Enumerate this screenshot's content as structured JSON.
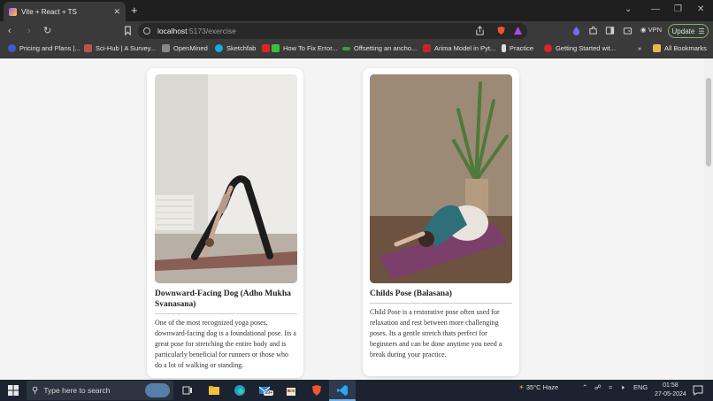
{
  "browser": {
    "tab_title": "Vite + React + TS",
    "new_tab": "+",
    "url_host": "localhost",
    "url_path": ":5173/exercise",
    "vpn_label": "VPN",
    "update_label": "Update",
    "window_controls": [
      "⌄",
      "—",
      "❐",
      "✕"
    ]
  },
  "bookmarks": [
    {
      "label": "Pricing and Plans |...",
      "color": "#3b5ccf"
    },
    {
      "label": "Sci-Hub | A Survey...",
      "color": "#c0504d"
    },
    {
      "label": "OpenMined",
      "color": "#888888"
    },
    {
      "label": "Sketchfab",
      "color": "#1caad9"
    },
    {
      "label": "How To Fix Error...",
      "color": "#e02424"
    },
    {
      "label": "Offsetting an ancho...",
      "color": "#3a9c3a"
    },
    {
      "label": "Arima Model in Pyt...",
      "color": "#c22727"
    },
    {
      "label": "Practice",
      "color": "#dddddd"
    },
    {
      "label": "Getting Started wit...",
      "color": "#e02424"
    },
    {
      "label": "All Bookmarks",
      "color": "#e6b84d"
    }
  ],
  "overflow_chevron": "»",
  "exercises": [
    {
      "title": "Downward-Facing Dog (Adho Mukha Svanasana)",
      "description": "One of the most recognized yoga poses, downward-facing dog is a foundational pose. Its a great pose for stretching the entire body and is particularly beneficial for runners or those who do a lot of walking or standing."
    },
    {
      "title": "Childs Pose (Balasana)",
      "description": "Child Pose is a restorative pose often used for relaxation and rest between more challenging poses. Its a gentle stretch thats perfect for beginners and can be done anytime you need a break during your practice."
    }
  ],
  "taskbar": {
    "search_placeholder": "Type here to search",
    "mail_badge": "99+",
    "weather": "35°C  Haze",
    "language": "ENG",
    "time": "01:58",
    "date": "27-05-2024"
  }
}
